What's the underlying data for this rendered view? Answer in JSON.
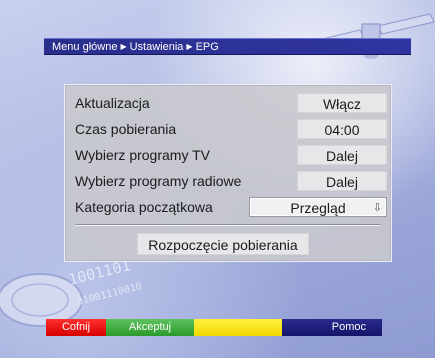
{
  "breadcrumb": {
    "items": [
      "Menu główne",
      "Ustawienia",
      "EPG"
    ]
  },
  "settings": {
    "rows": [
      {
        "label": "Aktualizacja",
        "value": "Włącz"
      },
      {
        "label": "Czas pobierania",
        "value": "04:00"
      },
      {
        "label": "Wybierz programy TV",
        "value": "Dalej"
      },
      {
        "label": "Wybierz programy radiowe",
        "value": "Dalej"
      },
      {
        "label": "Kategoria początkowa",
        "value": "Przegląd"
      }
    ],
    "start_button": "Rozpoczęcie pobierania"
  },
  "footer": {
    "red": "Cofnij",
    "green": "Akceptuj",
    "yellow": "",
    "blue": "Pomoc"
  },
  "colors": {
    "red_key": "#e00000",
    "green_key": "#3aa83a",
    "yellow_key": "#f5dd00",
    "blue_key": "#1e1e7a",
    "breadcrumb_bar": "#2c3196"
  },
  "icons": {
    "breadcrumb_separator": "triangle-right-icon",
    "select_arrow": "down-arrow-icon"
  }
}
